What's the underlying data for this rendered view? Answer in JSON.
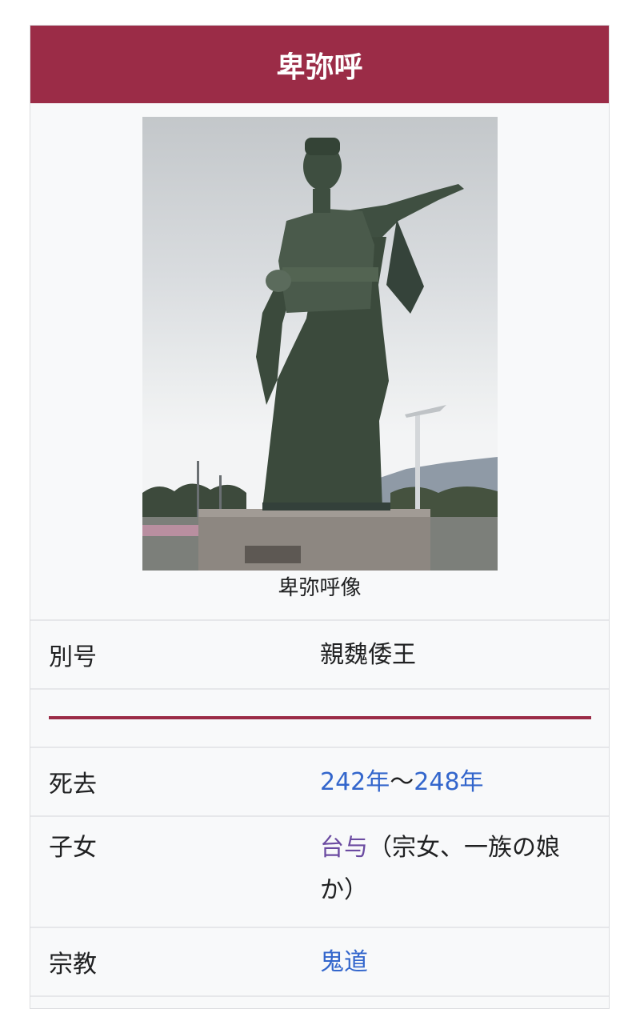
{
  "infobox": {
    "title": "卑弥呼",
    "image_caption": "卑弥呼像",
    "rows": {
      "alias": {
        "label": "別号",
        "value": "親魏倭王"
      },
      "death": {
        "label": "死去",
        "value_start": "242年",
        "value_sep": "〜",
        "value_end": "248年"
      },
      "children": {
        "label": "子女",
        "value_link": "台与",
        "value_text": "（宗女、一族の娘か）"
      },
      "religion": {
        "label": "宗教",
        "value_link": "鬼道"
      }
    }
  },
  "colors": {
    "title_background": "#9b2c47",
    "link": "#3366cc",
    "visited_link": "#6b4ba1",
    "box_background": "#f8f9fa"
  }
}
